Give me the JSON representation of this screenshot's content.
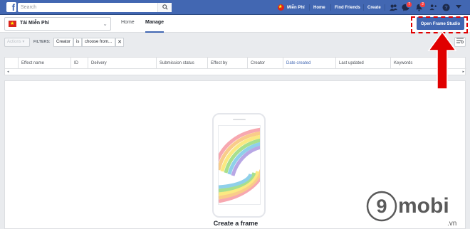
{
  "topbar": {
    "logo": "f",
    "search_placeholder": "Search",
    "user_name": "Miễn Phí",
    "nav": [
      "Home",
      "Find Friends",
      "Create"
    ],
    "badges": {
      "messages": "7",
      "notifications": "2"
    }
  },
  "page_header": {
    "page_name": "Tải Miễn Phí",
    "tabs": [
      "Home",
      "Manage"
    ],
    "active_tab": "Manage",
    "studio_button": "Open Frame Studio"
  },
  "filters": {
    "actions_label": "Actions",
    "filters_label": "FILTERS:",
    "pills": [
      "Creator",
      "is",
      "choose from..."
    ],
    "clear": "✕"
  },
  "table": {
    "columns": [
      "Effect name",
      "ID",
      "Delivery",
      "Submission status",
      "Effect by",
      "Creator",
      "Date created",
      "Last updated",
      "Keywords"
    ],
    "sorted_column": "Date created"
  },
  "empty_state": {
    "title": "Create a frame"
  },
  "watermark": {
    "brand_digit": "9",
    "brand_text": "mobi",
    "brand_suffix": ".vn"
  },
  "colors": {
    "fb_blue": "#4267b2",
    "highlight_red": "#e00000"
  }
}
